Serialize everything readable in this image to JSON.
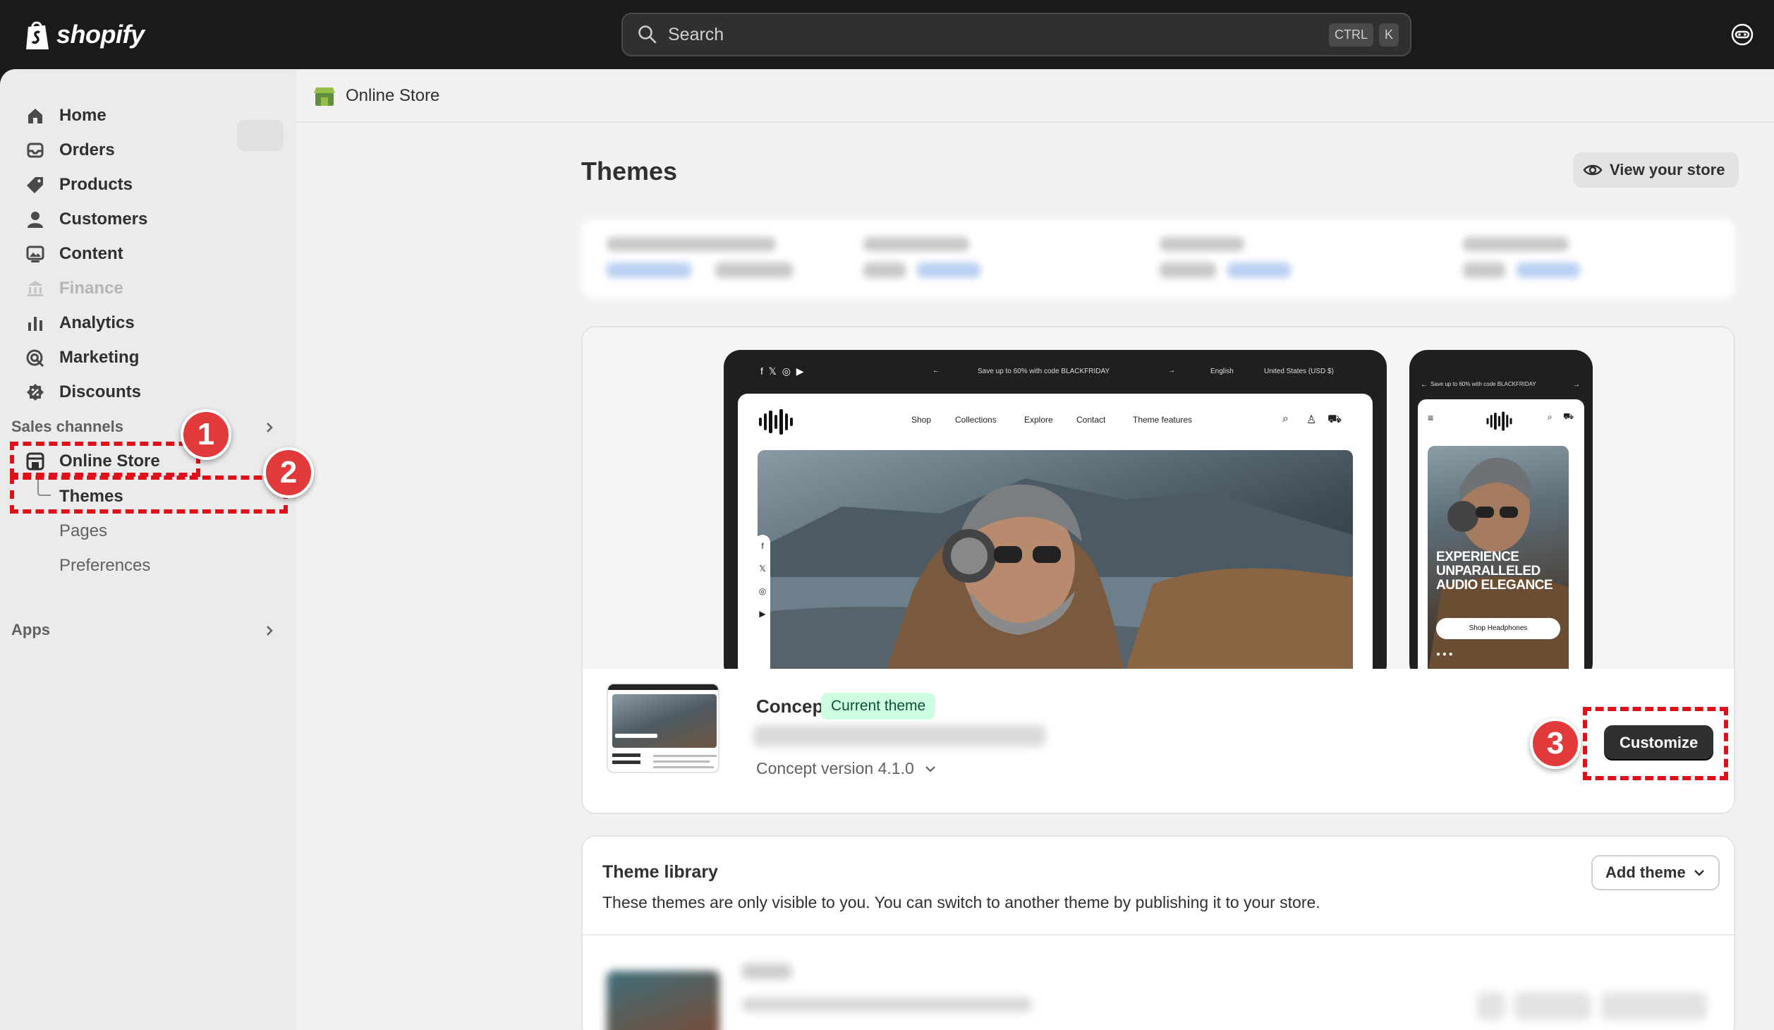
{
  "topbar": {
    "logo_text": "shopify",
    "search_placeholder": "Search",
    "shortcut_keys": [
      "CTRL",
      "K"
    ]
  },
  "sidebar": {
    "items": [
      {
        "label": "Home",
        "icon": "home-icon"
      },
      {
        "label": "Orders",
        "icon": "inbox-icon"
      },
      {
        "label": "Products",
        "icon": "tag-icon"
      },
      {
        "label": "Customers",
        "icon": "person-icon"
      },
      {
        "label": "Content",
        "icon": "image-icon"
      },
      {
        "label": "Finance",
        "icon": "bank-icon",
        "disabled": true
      },
      {
        "label": "Analytics",
        "icon": "bar-chart-icon"
      },
      {
        "label": "Marketing",
        "icon": "target-icon"
      },
      {
        "label": "Discounts",
        "icon": "discount-icon"
      }
    ],
    "sales_channels_label": "Sales channels",
    "online_store_label": "Online Store",
    "sub_items": [
      "Themes",
      "Pages",
      "Preferences"
    ],
    "apps_label": "Apps"
  },
  "breadcrumb": {
    "label": "Online Store"
  },
  "page": {
    "title": "Themes",
    "view_store_label": "View your store"
  },
  "preview": {
    "announcement": "Save up to 60% with code BLACKFRIDAY",
    "language": "English",
    "currency": "United States (USD $)",
    "nav_links": [
      "Shop",
      "Collections",
      "Explore",
      "Contact",
      "Theme features"
    ],
    "mobile_announcement": "Save up to 60% with code BLACKFRIDAY",
    "mobile_headline": "EXPERIENCE UNPARALLELED AUDIO ELEGANCE",
    "mobile_button": "Shop Headphones"
  },
  "current_theme": {
    "name": "Concept",
    "badge": "Current theme",
    "version": "Concept version 4.1.0",
    "customize_label": "Customize"
  },
  "library": {
    "title": "Theme library",
    "description": "These themes are only visible to you. You can switch to another theme by publishing it to your store.",
    "add_theme_label": "Add theme"
  },
  "annotations": {
    "markers": [
      "1",
      "2",
      "3"
    ],
    "color": "#e0101b"
  }
}
